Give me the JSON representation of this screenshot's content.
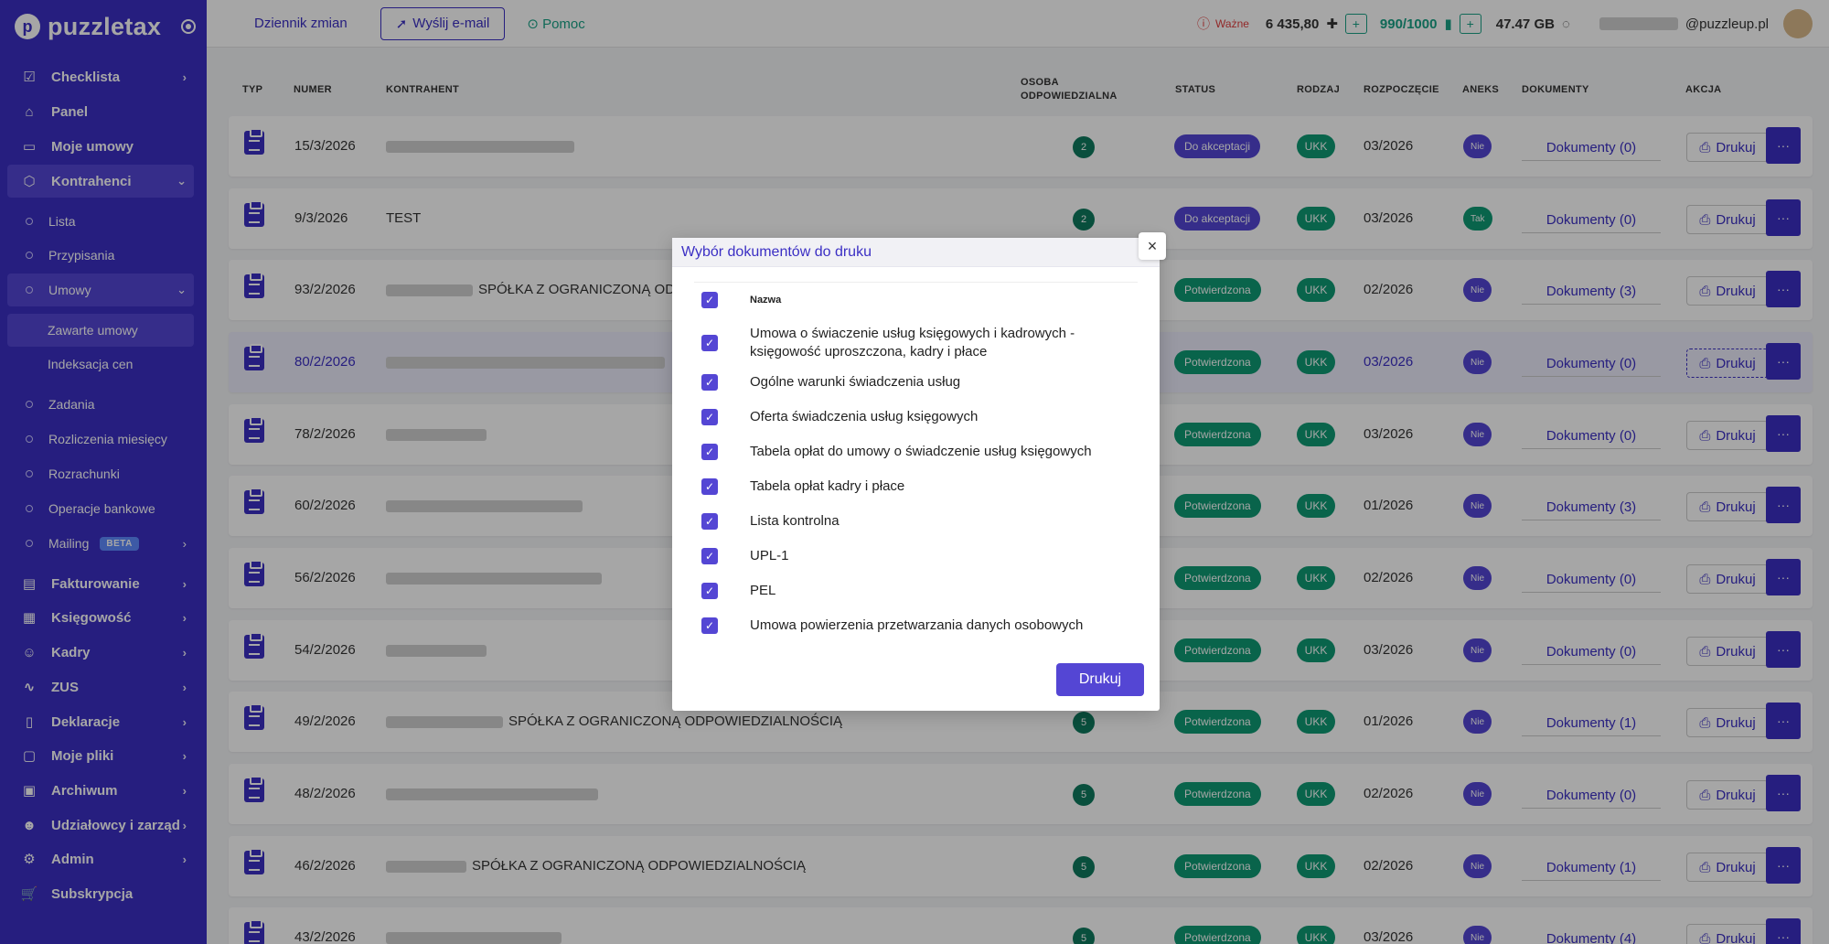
{
  "app": {
    "name": "puzzletax"
  },
  "sidebar": {
    "items": [
      {
        "label": "Checklista",
        "icon": "checklist-icon",
        "chevron": "›"
      },
      {
        "label": "Panel",
        "icon": "home-icon"
      },
      {
        "label": "Moje umowy",
        "icon": "briefcase-icon"
      },
      {
        "label": "Kontrahenci",
        "icon": "box-icon",
        "chevron": "⌄"
      }
    ],
    "kontrahenci_sub": [
      {
        "label": "Lista"
      },
      {
        "label": "Przypisania"
      },
      {
        "label": "Umowy",
        "chevron": "⌄"
      }
    ],
    "umowy_sub": [
      {
        "label": "Zawarte umowy"
      },
      {
        "label": "Indeksacja cen"
      }
    ],
    "more_sub": [
      {
        "label": "Zadania"
      },
      {
        "label": "Rozliczenia miesięcy"
      },
      {
        "label": "Rozrachunki"
      },
      {
        "label": "Operacje bankowe"
      },
      {
        "label": "Mailing",
        "badge": "BETA",
        "chevron": "›"
      }
    ],
    "bottom_items": [
      {
        "label": "Fakturowanie",
        "icon": "invoice-icon",
        "chevron": "›"
      },
      {
        "label": "Księgowość",
        "icon": "ledger-icon",
        "chevron": "›"
      },
      {
        "label": "Kadry",
        "icon": "people-icon",
        "chevron": "›"
      },
      {
        "label": "ZUS",
        "icon": "pulse-icon",
        "chevron": "›"
      },
      {
        "label": "Deklaracje",
        "icon": "book-icon",
        "chevron": "›"
      },
      {
        "label": "Moje pliki",
        "icon": "folder-icon",
        "chevron": "›"
      },
      {
        "label": "Archiwum",
        "icon": "archive-icon",
        "chevron": "›"
      },
      {
        "label": "Udziałowcy i zarząd",
        "icon": "users-icon",
        "chevron": "›"
      },
      {
        "label": "Admin",
        "icon": "gear-icon",
        "chevron": "›"
      },
      {
        "label": "Subskrypcja",
        "icon": "cart-icon"
      }
    ]
  },
  "topbar": {
    "changelog": "Dziennik zmian",
    "send_email": "Wyślij e-mail",
    "help": "Pomoc",
    "important": "Ważne",
    "credits": "6 435,80",
    "plus": "+",
    "docs_quota": "990/1000",
    "storage": "47.47 GB",
    "email_suffix": "@puzzleup.pl"
  },
  "table": {
    "headers": {
      "typ": "TYP",
      "numer": "NUMER",
      "kontrahent": "KONTRAHENT",
      "osoba_1": "OSOBA",
      "osoba_2": "ODPOWIEDZIALNA",
      "status": "STATUS",
      "rodzaj": "RODZAJ",
      "rozpoczecie": "ROZPOCZĘCIE",
      "aneks": "ANEKS",
      "dokumenty": "DOKUMENTY",
      "akcja": "AKCJA"
    },
    "print_label": "Drukuj",
    "more_label": "···",
    "rows": [
      {
        "numer": "15/3/2026",
        "kontrahent": "",
        "osoba": "2",
        "status": "Do akceptacji",
        "rodzaj": "UKK",
        "start": "03/2026",
        "aneks": "Nie",
        "dok": "Dokumenty (0)"
      },
      {
        "numer": "9/3/2026",
        "kontrahent": "TEST",
        "osoba": "2",
        "status": "Do akceptacji",
        "rodzaj": "UKK",
        "start": "03/2026",
        "aneks": "Tak",
        "dok": "Dokumenty (0)"
      },
      {
        "numer": "93/2/2026",
        "kontrahent": "SPÓŁKA Z OGRANICZONĄ ODP",
        "osoba": "",
        "status": "Potwierdzona",
        "rodzaj": "UKK",
        "start": "02/2026",
        "aneks": "Nie",
        "dok": "Dokumenty (3)"
      },
      {
        "numer": "80/2/2026",
        "kontrahent": "",
        "osoba": "",
        "status": "Potwierdzona",
        "rodzaj": "UKK",
        "start": "03/2026",
        "aneks": "Nie",
        "dok": "Dokumenty (0)"
      },
      {
        "numer": "78/2/2026",
        "kontrahent": "",
        "osoba": "",
        "status": "Potwierdzona",
        "rodzaj": "UKK",
        "start": "03/2026",
        "aneks": "Nie",
        "dok": "Dokumenty (0)"
      },
      {
        "numer": "60/2/2026",
        "kontrahent": "",
        "osoba": "",
        "status": "Potwierdzona",
        "rodzaj": "UKK",
        "start": "01/2026",
        "aneks": "Nie",
        "dok": "Dokumenty (3)"
      },
      {
        "numer": "56/2/2026",
        "kontrahent": "",
        "osoba": "",
        "status": "Potwierdzona",
        "rodzaj": "UKK",
        "start": "02/2026",
        "aneks": "Nie",
        "dok": "Dokumenty (0)"
      },
      {
        "numer": "54/2/2026",
        "kontrahent": "",
        "osoba": "",
        "status": "Potwierdzona",
        "rodzaj": "UKK",
        "start": "03/2026",
        "aneks": "Nie",
        "dok": "Dokumenty (0)"
      },
      {
        "numer": "49/2/2026",
        "kontrahent": "SPÓŁKA Z OGRANICZONĄ ODPOWIEDZIALNOŚCIĄ",
        "osoba": "5",
        "status": "Potwierdzona",
        "rodzaj": "UKK",
        "start": "01/2026",
        "aneks": "Nie",
        "dok": "Dokumenty (1)"
      },
      {
        "numer": "48/2/2026",
        "kontrahent": "",
        "osoba": "5",
        "status": "Potwierdzona",
        "rodzaj": "UKK",
        "start": "02/2026",
        "aneks": "Nie",
        "dok": "Dokumenty (0)"
      },
      {
        "numer": "46/2/2026",
        "kontrahent": "SPÓŁKA Z OGRANICZONĄ ODPOWIEDZIALNOŚCIĄ",
        "osoba": "5",
        "status": "Potwierdzona",
        "rodzaj": "UKK",
        "start": "02/2026",
        "aneks": "Nie",
        "dok": "Dokumenty (1)"
      },
      {
        "numer": "43/2/2026",
        "kontrahent": "",
        "osoba": "5",
        "status": "Potwierdzona",
        "rodzaj": "UKK",
        "start": "03/2026",
        "aneks": "Nie",
        "dok": "Dokumenty (4)"
      }
    ]
  },
  "modal": {
    "title": "Wybór dokumentów do druku",
    "close": "×",
    "header_label": "Nazwa",
    "check": "✓",
    "documents": [
      "Umowa o świaczenie usług księgowych i kadrowych - księgowość uproszczona, kadry i płace",
      "Ogólne warunki świadczenia usług",
      "Oferta świadczenia usług księgowych",
      "Tabela opłat do umowy o świadczenie usług księgowych",
      "Tabela opłat kadry i płace",
      "Lista kontrolna",
      "UPL-1",
      "PEL",
      "Umowa powierzenia przetwarzania danych osobowych"
    ],
    "print_button": "Drukuj"
  },
  "colors": {
    "primary": "#3b2fc4",
    "accent": "#5446d4",
    "success": "#0e9a73",
    "warning": "#e03e3e"
  }
}
